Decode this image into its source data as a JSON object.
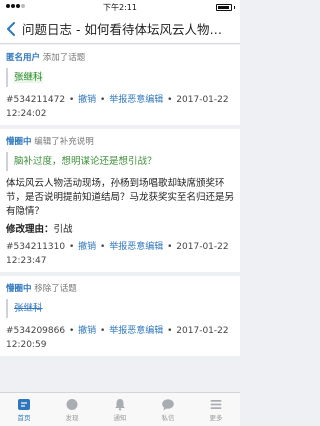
{
  "status_bar": {
    "time": "下午2:11"
  },
  "nav": {
    "title": "问题日志 - 如何看待体坛风云人物活动..."
  },
  "entries": [
    {
      "user": "匿名用户",
      "action_text": "添加了话题",
      "quote": "张继科",
      "log_id": "#534211472",
      "actions": [
        "撤销",
        "举报恶意编辑"
      ],
      "time_line1": "2017-01-22",
      "time_line2": "12:24:02"
    },
    {
      "user": "懵圈中",
      "action_text": "编辑了补充说明",
      "quote": "脑补过度，想明谋论还是想引战？",
      "body": "体坛风云人物活动现场，孙杨到场唱歌却缺席颁奖环节，是否说明提前知道结局？马龙获奖实至名归还是另有隐情？",
      "reason_label": "修改理由",
      "reason_value": "引战",
      "log_id": "#534211310",
      "actions": [
        "撤销",
        "举报恶意编辑"
      ],
      "time_line1": "2017-01-22",
      "time_line2": "12:23:47"
    },
    {
      "user": "懵圈中",
      "action_text": "移除了话题",
      "quote": "张继科",
      "log_id": "#534209866",
      "actions": [
        "撤销",
        "举报恶意编辑"
      ],
      "time_line1": "2017-01-22",
      "time_line2": "12:20:59"
    }
  ],
  "tabs": [
    {
      "label": "首页",
      "icon": "home-icon",
      "active": true
    },
    {
      "label": "发现",
      "icon": "compass-icon",
      "active": false
    },
    {
      "label": "通知",
      "icon": "bell-icon",
      "active": false
    },
    {
      "label": "私信",
      "icon": "chat-icon",
      "active": false
    },
    {
      "label": "更多",
      "icon": "menu-icon",
      "active": false
    }
  ],
  "colors": {
    "accent": "#2f77bd",
    "quote_green": "#3f8f3a"
  }
}
